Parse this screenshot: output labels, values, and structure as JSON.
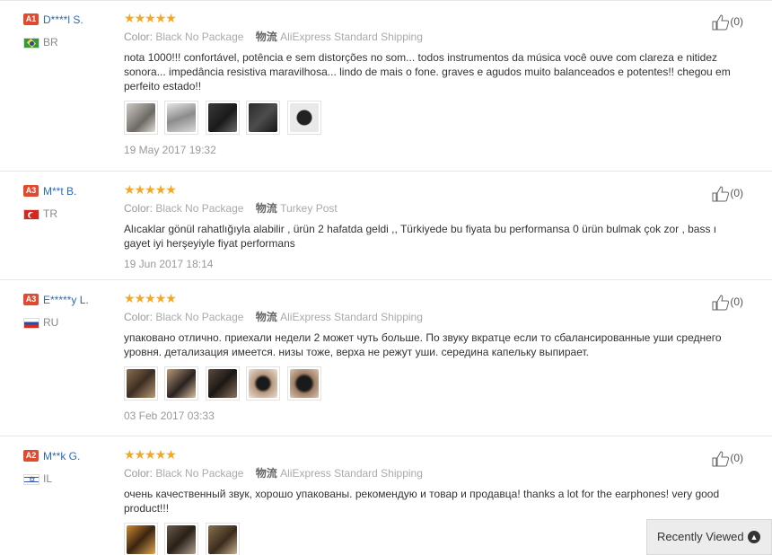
{
  "labels": {
    "color": "Color:",
    "shipping_icon": "物流",
    "helpful_count_prefix": "(",
    "helpful_count_suffix": ")"
  },
  "reviews": [
    {
      "level": "A1",
      "user": "D****l S.",
      "country": "BR",
      "flag": "brazil-flag",
      "stars": 5,
      "color_value": "Black No Package",
      "shipping": "AliExpress Standard Shipping",
      "text": "nota 1000!!! confortável, potência e sem distorções no som... todos instrumentos da música você ouve com clareza e nitidez sonora... impedância resistiva maravilhosa... lindo de mais o fone. graves e agudos muito balanceados e potentes!! chegou em perfeito estado!!",
      "photos": 5,
      "date": "19 May 2017 19:32",
      "helpful": "(0)"
    },
    {
      "level": "A3",
      "user": "M**t B.",
      "country": "TR",
      "flag": "turkey-flag",
      "stars": 5,
      "color_value": "Black No Package",
      "shipping": "Turkey Post",
      "text": "Alıcaklar gönül rahatlığıyla alabilir , ürün 2 hafatda geldi ,, Türkiyede bu fiyata bu performansa 0 ürün bulmak çok zor , bass ı gayet iyi herşeyiyle fiyat performans",
      "photos": 0,
      "date": "19 Jun 2017 18:14",
      "helpful": "(0)"
    },
    {
      "level": "A3",
      "user": "E*****y L.",
      "country": "RU",
      "flag": "russia-flag",
      "stars": 5,
      "color_value": "Black No Package",
      "shipping": "AliExpress Standard Shipping",
      "text": "упаковано отлично. приехали недели 2 может чуть больше. По звуку вкратце если то сбалансированные уши среднего уровня. детализация имеется. низы тоже, верха не режут уши. середина капельку выпирает.",
      "photos": 5,
      "date": "03 Feb 2017 03:33",
      "helpful": "(0)"
    },
    {
      "level": "A2",
      "user": "M**k G.",
      "country": "IL",
      "flag": "israel-flag",
      "stars": 5,
      "color_value": "Black No Package",
      "shipping": "AliExpress Standard Shipping",
      "text": "очень качественный звук, хорошо упакованы. рекомендую и товар и продавца! thanks a lot for the earphones! very good product!!!",
      "photos": 3,
      "date": "",
      "helpful": "(0)"
    }
  ],
  "recently_viewed": "Recently Viewed",
  "colors": {
    "level_badge": "#e04a2f",
    "username": "#2a6ab8",
    "stars": "#f5a623"
  }
}
